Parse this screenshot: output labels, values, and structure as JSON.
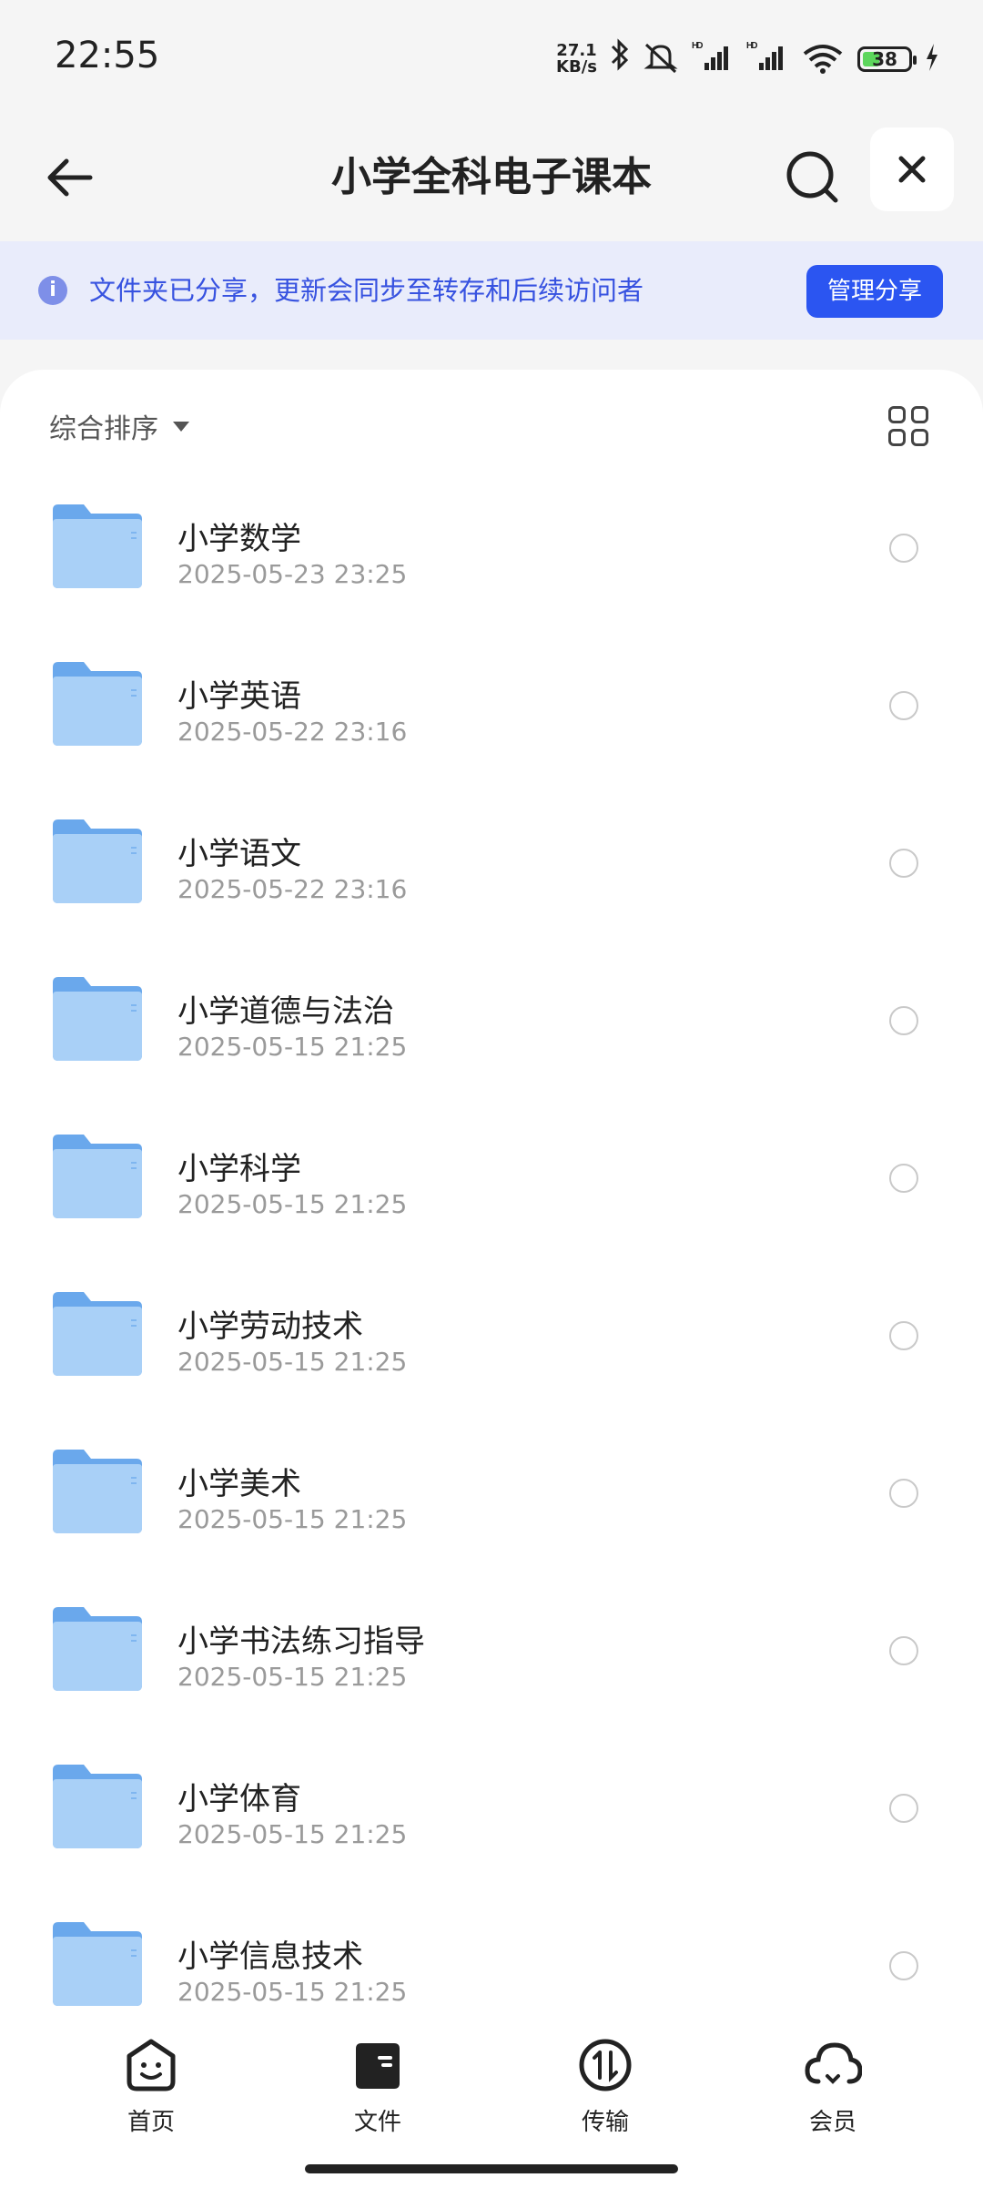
{
  "status_bar": {
    "time": "22:55",
    "net_speed_value": "27.1",
    "net_speed_unit": "KB/s",
    "signal_1_label": "HD",
    "signal_2_label": "HD",
    "battery_level": "38"
  },
  "header": {
    "title": "小学全科电子课本"
  },
  "banner": {
    "message": "文件夹已分享，更新会同步至转存和后续访问者",
    "button_label": "管理分享"
  },
  "sort": {
    "label": "综合排序"
  },
  "files": [
    {
      "name": "小学数学",
      "date": "2025-05-23 23:25"
    },
    {
      "name": "小学英语",
      "date": "2025-05-22 23:16"
    },
    {
      "name": "小学语文",
      "date": "2025-05-22 23:16"
    },
    {
      "name": "小学道德与法治",
      "date": "2025-05-15 21:25"
    },
    {
      "name": "小学科学",
      "date": "2025-05-15 21:25"
    },
    {
      "name": "小学劳动技术",
      "date": "2025-05-15 21:25"
    },
    {
      "name": "小学美术",
      "date": "2025-05-15 21:25"
    },
    {
      "name": "小学书法练习指导",
      "date": "2025-05-15 21:25"
    },
    {
      "name": "小学体育",
      "date": "2025-05-15 21:25"
    },
    {
      "name": "小学信息技术",
      "date": "2025-05-15 21:25"
    }
  ],
  "tabs": [
    {
      "label": "首页",
      "icon": "smile-face-icon"
    },
    {
      "label": "文件",
      "icon": "wallet-folder-icon"
    },
    {
      "label": "传输",
      "icon": "transfer-arrows-icon"
    },
    {
      "label": "会员",
      "icon": "cloud-icon"
    }
  ],
  "colors": {
    "accent": "#2b55f1",
    "banner_bg": "#e9ecfb",
    "banner_text": "#3752e0",
    "folder": "#7fb6f0"
  }
}
